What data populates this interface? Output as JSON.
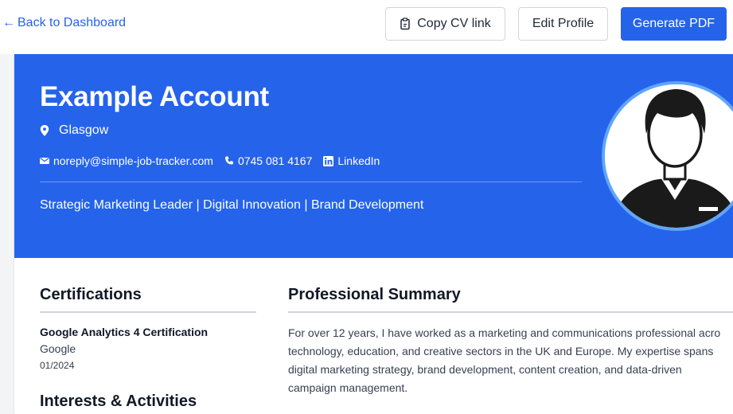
{
  "nav": {
    "back_label": "Back to Dashboard",
    "copy_label": "Copy CV link",
    "edit_label": "Edit Profile",
    "pdf_label": "Generate PDF"
  },
  "profile": {
    "name": "Example Account",
    "location": "Glasgow",
    "email": "noreply@simple-job-tracker.com",
    "phone": "0745 081 4167",
    "linkedin": "LinkedIn",
    "headline": "Strategic Marketing Leader | Digital Innovation | Brand Development"
  },
  "sections": {
    "certifications_title": "Certifications",
    "interests_title": "Interests & Activities",
    "summary_title": "Professional Summary"
  },
  "certifications": [
    {
      "name": "Google Analytics 4 Certification",
      "issuer": "Google",
      "date": "01/2024"
    }
  ],
  "summary_lines": [
    "For over 12 years, I have worked as a marketing and communications professional acro",
    "technology, education, and creative sectors in the UK and Europe. My expertise spans",
    "digital marketing strategy, brand development, content creation, and data-driven",
    "campaign management."
  ],
  "colors": {
    "accent": "#2563eb",
    "avatar_ring": "#60a5fa"
  },
  "icons": [
    "arrow-left-icon",
    "clipboard-icon",
    "map-pin-icon",
    "mail-icon",
    "phone-icon",
    "linkedin-icon"
  ]
}
